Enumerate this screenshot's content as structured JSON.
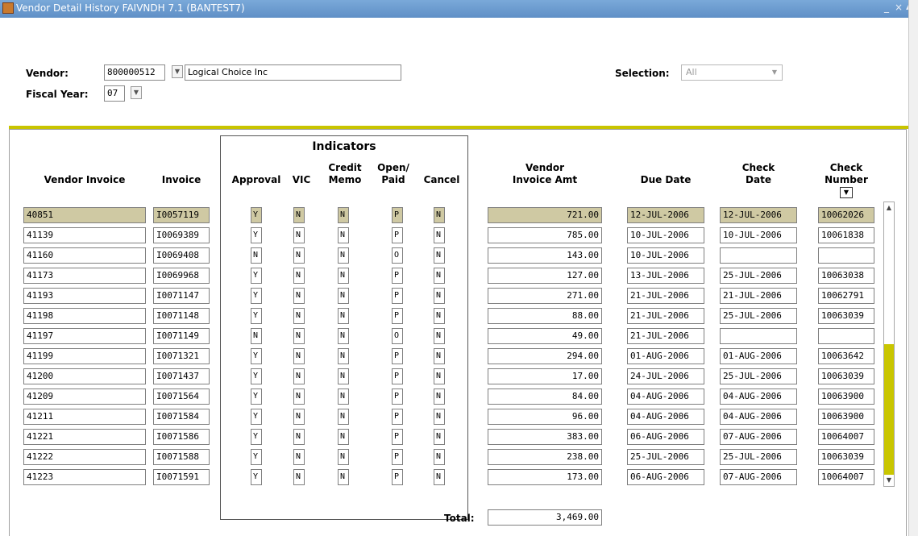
{
  "window": {
    "title": "Vendor Detail History  FAIVNDH  7.1  (BANTEST7)",
    "buttons": [
      "_",
      "×",
      "▲"
    ]
  },
  "key_block": {
    "vendor_label": "Vendor:",
    "vendor_id": "800000512",
    "vendor_name": "Logical Choice Inc",
    "fiscal_year_label": "Fiscal Year:",
    "fiscal_year": "07",
    "selection_label": "Selection:",
    "selection_value": "All"
  },
  "headers": {
    "vendor_invoice": "Vendor Invoice",
    "invoice": "Invoice",
    "indicators": "Indicators",
    "approval": "Approval",
    "vic": "VIC",
    "credit_memo": "Credit\nMemo",
    "open_paid": "Open/\nPaid",
    "cancel": "Cancel",
    "vendor_invoice_amt": "Vendor\nInvoice Amt",
    "due_date": "Due Date",
    "check_date": "Check\nDate",
    "check_number": "Check\nNumber"
  },
  "rows": [
    {
      "vendor_invoice": "40851",
      "invoice": "I0057119",
      "approval": "Y",
      "vic": "N",
      "credit_memo": "N",
      "open_paid": "P",
      "cancel": "N",
      "amount": "721.00",
      "due_date": "12-JUL-2006",
      "check_date": "12-JUL-2006",
      "check_number": "10062026"
    },
    {
      "vendor_invoice": "41139",
      "invoice": "I0069389",
      "approval": "Y",
      "vic": "N",
      "credit_memo": "N",
      "open_paid": "P",
      "cancel": "N",
      "amount": "785.00",
      "due_date": "10-JUL-2006",
      "check_date": "10-JUL-2006",
      "check_number": "10061838"
    },
    {
      "vendor_invoice": "41160",
      "invoice": "I0069408",
      "approval": "N",
      "vic": "N",
      "credit_memo": "N",
      "open_paid": "O",
      "cancel": "N",
      "amount": "143.00",
      "due_date": "10-JUL-2006",
      "check_date": "",
      "check_number": ""
    },
    {
      "vendor_invoice": "41173",
      "invoice": "I0069968",
      "approval": "Y",
      "vic": "N",
      "credit_memo": "N",
      "open_paid": "P",
      "cancel": "N",
      "amount": "127.00",
      "due_date": "13-JUL-2006",
      "check_date": "25-JUL-2006",
      "check_number": "10063038"
    },
    {
      "vendor_invoice": "41193",
      "invoice": "I0071147",
      "approval": "Y",
      "vic": "N",
      "credit_memo": "N",
      "open_paid": "P",
      "cancel": "N",
      "amount": "271.00",
      "due_date": "21-JUL-2006",
      "check_date": "21-JUL-2006",
      "check_number": "10062791"
    },
    {
      "vendor_invoice": "41198",
      "invoice": "I0071148",
      "approval": "Y",
      "vic": "N",
      "credit_memo": "N",
      "open_paid": "P",
      "cancel": "N",
      "amount": "88.00",
      "due_date": "21-JUL-2006",
      "check_date": "25-JUL-2006",
      "check_number": "10063039"
    },
    {
      "vendor_invoice": "41197",
      "invoice": "I0071149",
      "approval": "N",
      "vic": "N",
      "credit_memo": "N",
      "open_paid": "O",
      "cancel": "N",
      "amount": "49.00",
      "due_date": "21-JUL-2006",
      "check_date": "",
      "check_number": ""
    },
    {
      "vendor_invoice": "41199",
      "invoice": "I0071321",
      "approval": "Y",
      "vic": "N",
      "credit_memo": "N",
      "open_paid": "P",
      "cancel": "N",
      "amount": "294.00",
      "due_date": "01-AUG-2006",
      "check_date": "01-AUG-2006",
      "check_number": "10063642"
    },
    {
      "vendor_invoice": "41200",
      "invoice": "I0071437",
      "approval": "Y",
      "vic": "N",
      "credit_memo": "N",
      "open_paid": "P",
      "cancel": "N",
      "amount": "17.00",
      "due_date": "24-JUL-2006",
      "check_date": "25-JUL-2006",
      "check_number": "10063039"
    },
    {
      "vendor_invoice": "41209",
      "invoice": "I0071564",
      "approval": "Y",
      "vic": "N",
      "credit_memo": "N",
      "open_paid": "P",
      "cancel": "N",
      "amount": "84.00",
      "due_date": "04-AUG-2006",
      "check_date": "04-AUG-2006",
      "check_number": "10063900"
    },
    {
      "vendor_invoice": "41211",
      "invoice": "I0071584",
      "approval": "Y",
      "vic": "N",
      "credit_memo": "N",
      "open_paid": "P",
      "cancel": "N",
      "amount": "96.00",
      "due_date": "04-AUG-2006",
      "check_date": "04-AUG-2006",
      "check_number": "10063900"
    },
    {
      "vendor_invoice": "41221",
      "invoice": "I0071586",
      "approval": "Y",
      "vic": "N",
      "credit_memo": "N",
      "open_paid": "P",
      "cancel": "N",
      "amount": "383.00",
      "due_date": "06-AUG-2006",
      "check_date": "07-AUG-2006",
      "check_number": "10064007"
    },
    {
      "vendor_invoice": "41222",
      "invoice": "I0071588",
      "approval": "Y",
      "vic": "N",
      "credit_memo": "N",
      "open_paid": "P",
      "cancel": "N",
      "amount": "238.00",
      "due_date": "25-JUL-2006",
      "check_date": "25-JUL-2006",
      "check_number": "10063039"
    },
    {
      "vendor_invoice": "41223",
      "invoice": "I0071591",
      "approval": "Y",
      "vic": "N",
      "credit_memo": "N",
      "open_paid": "P",
      "cancel": "N",
      "amount": "173.00",
      "due_date": "06-AUG-2006",
      "check_date": "07-AUG-2006",
      "check_number": "10064007"
    }
  ],
  "total_label": "Total:",
  "total_value": "3,469.00",
  "colors": {
    "accent": "#c8c400",
    "selected_row": "#cfc9a3",
    "titlebar": "#6b9bd1"
  }
}
